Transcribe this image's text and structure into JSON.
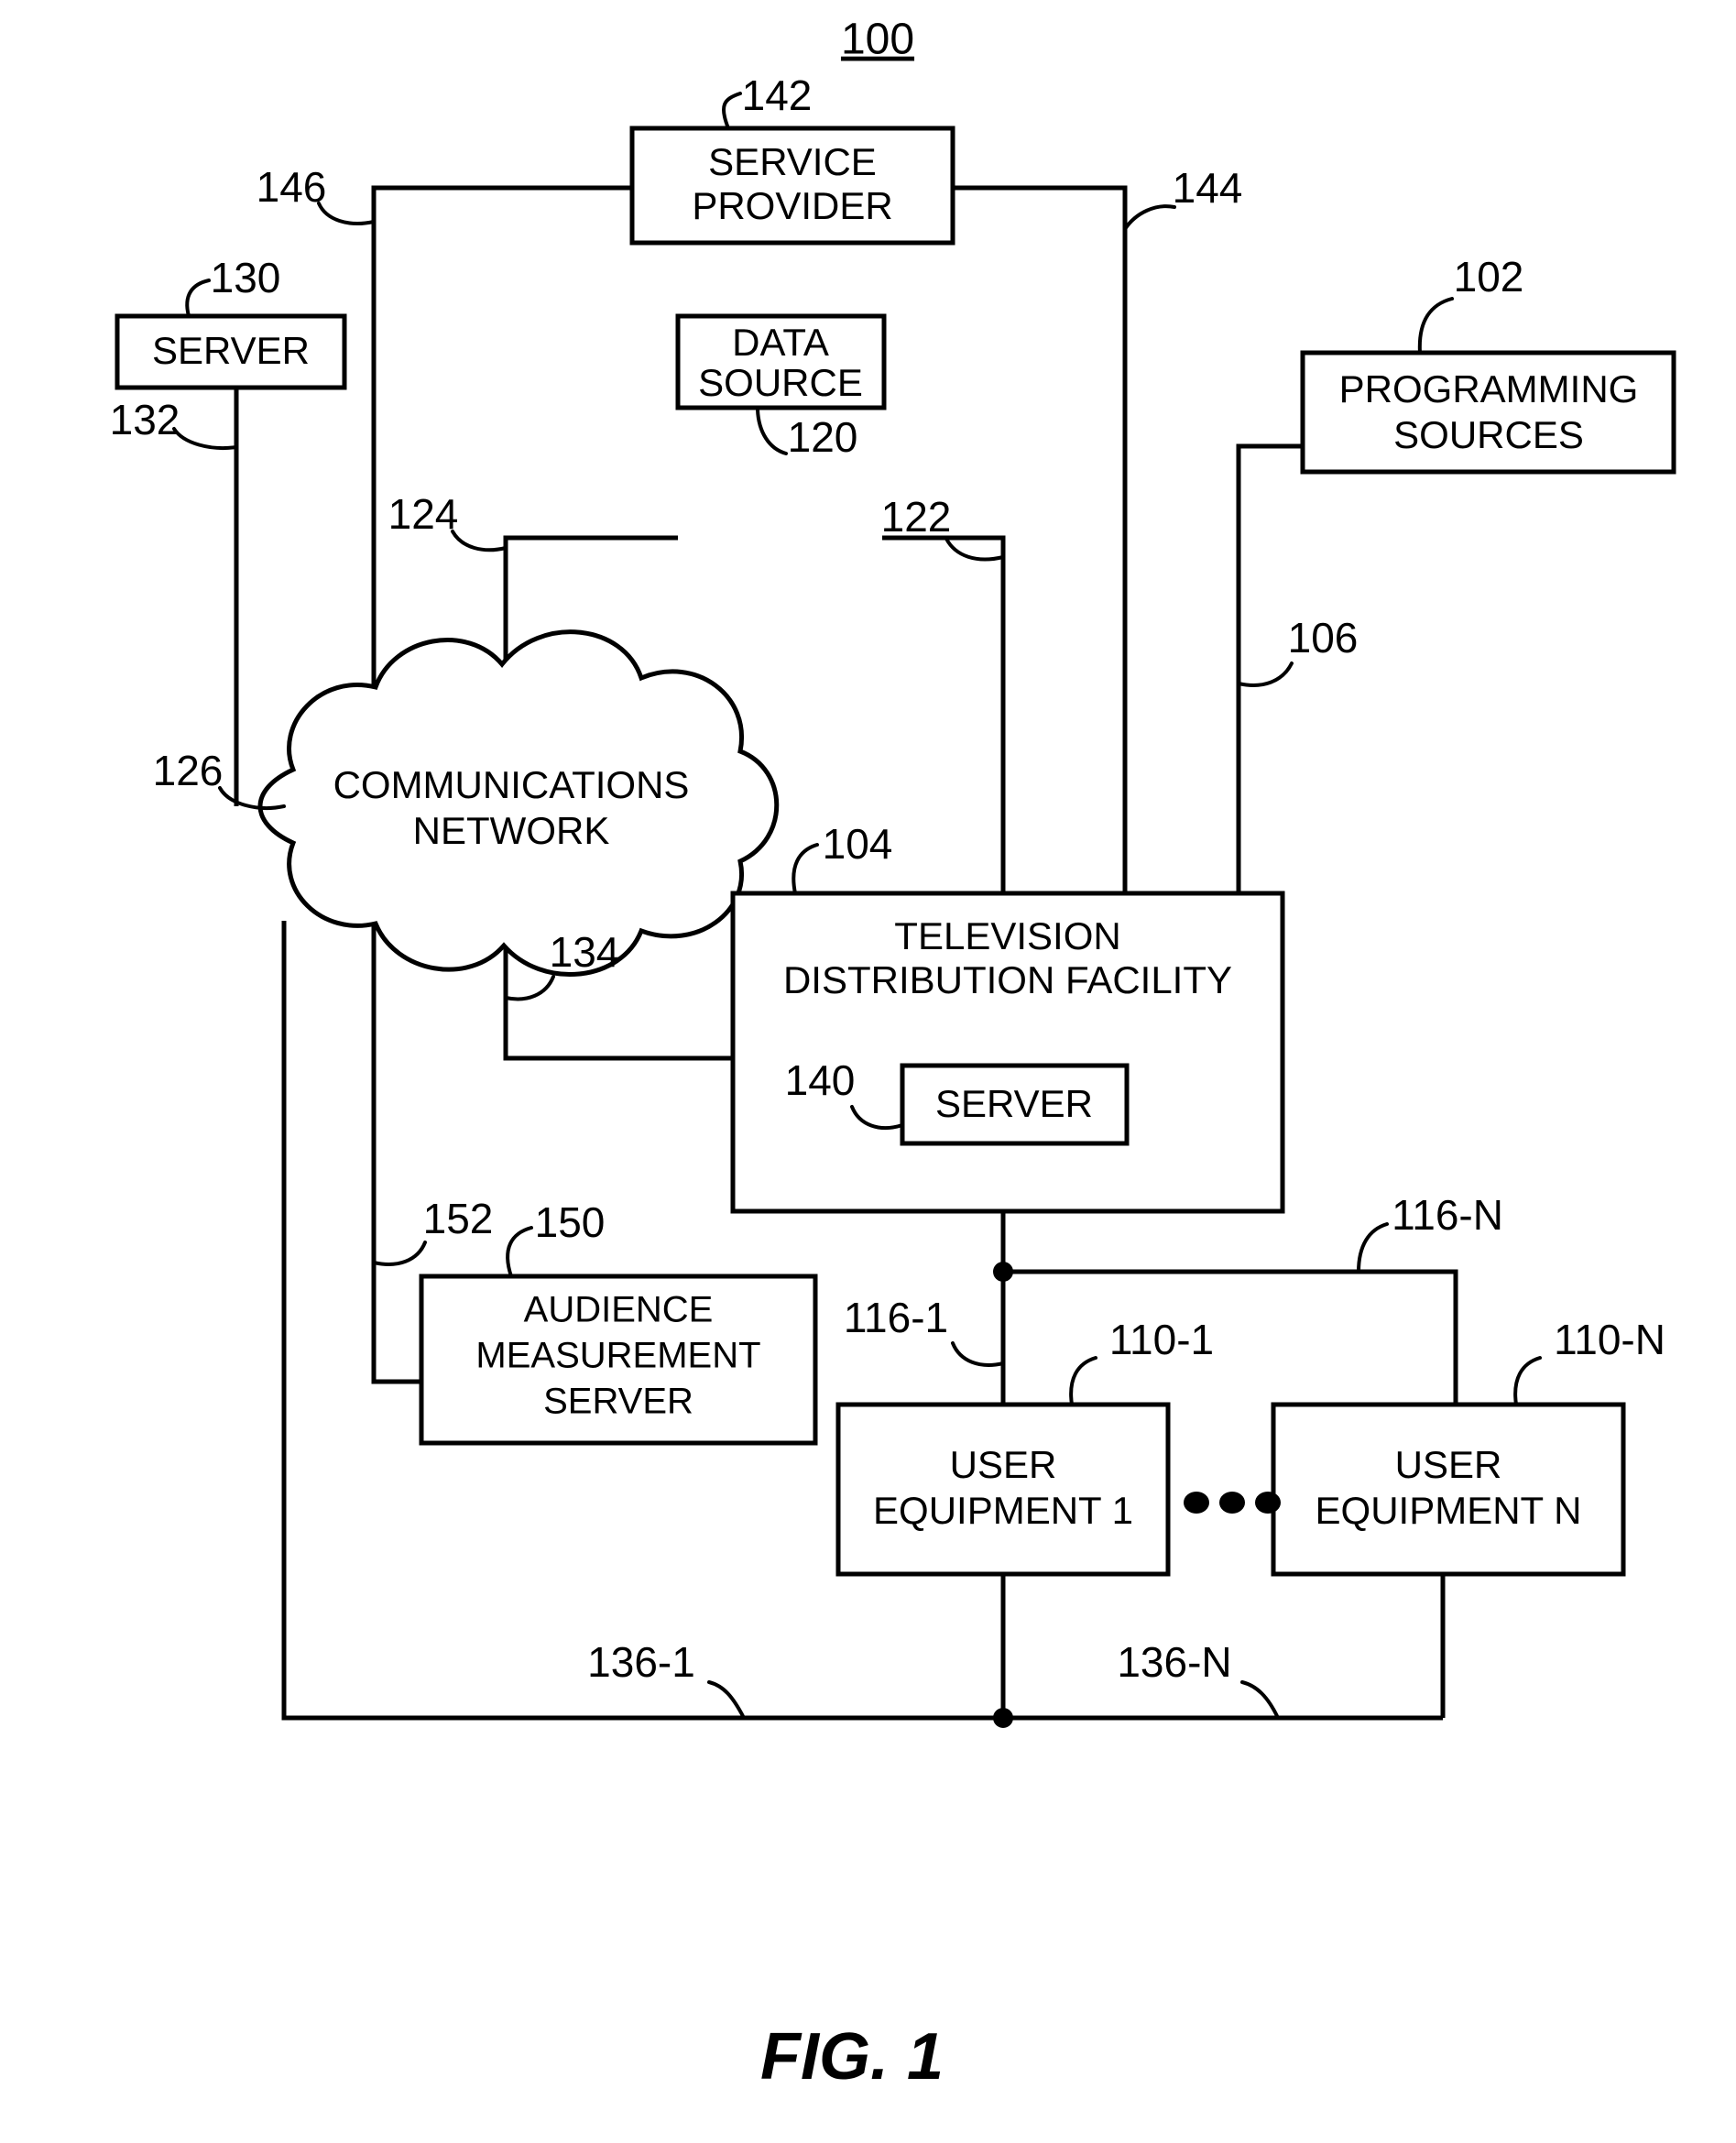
{
  "figure": {
    "figure_ref_number": "100",
    "caption": "FIG. 1"
  },
  "nodes": {
    "service_provider": {
      "line1": "SERVICE",
      "line2": "PROVIDER",
      "ref": "142"
    },
    "programming_sources": {
      "line1": "PROGRAMMING",
      "line2": "SOURCES",
      "ref": "102"
    },
    "server_130": {
      "line1": "SERVER",
      "ref": "130"
    },
    "data_source": {
      "line1": "DATA",
      "line2": "SOURCE",
      "ref": "120"
    },
    "communications_network": {
      "line1": "COMMUNICATIONS",
      "line2": "NETWORK",
      "ref": "126"
    },
    "television_distribution_facility": {
      "line1": "TELEVISION",
      "line2": "DISTRIBUTION FACILITY",
      "ref": "104"
    },
    "server_140": {
      "line1": "SERVER",
      "ref": "140"
    },
    "audience_measurement_server": {
      "line1": "AUDIENCE",
      "line2": "MEASUREMENT",
      "line3": "SERVER",
      "ref": "150"
    },
    "user_equipment_1": {
      "line1": "USER",
      "line2": "EQUIPMENT 1",
      "ref": "110-1"
    },
    "user_equipment_n": {
      "line1": "USER",
      "line2": "EQUIPMENT N",
      "ref": "110-N"
    }
  },
  "connection_refs": {
    "sp_to_network": "146",
    "sp_to_tdf": "144",
    "ps_to_tdf": "106",
    "server130_to_network": "132",
    "datasource_to_network": "124",
    "datasource_to_tdf": "122",
    "network_to_tdf": "134",
    "network_to_ams": "152",
    "tdf_to_ue1": "116-1",
    "tdf_to_uen": "116-N",
    "ue1_to_network": "136-1",
    "uen_to_network": "136-N"
  },
  "ellipsis": "•••"
}
